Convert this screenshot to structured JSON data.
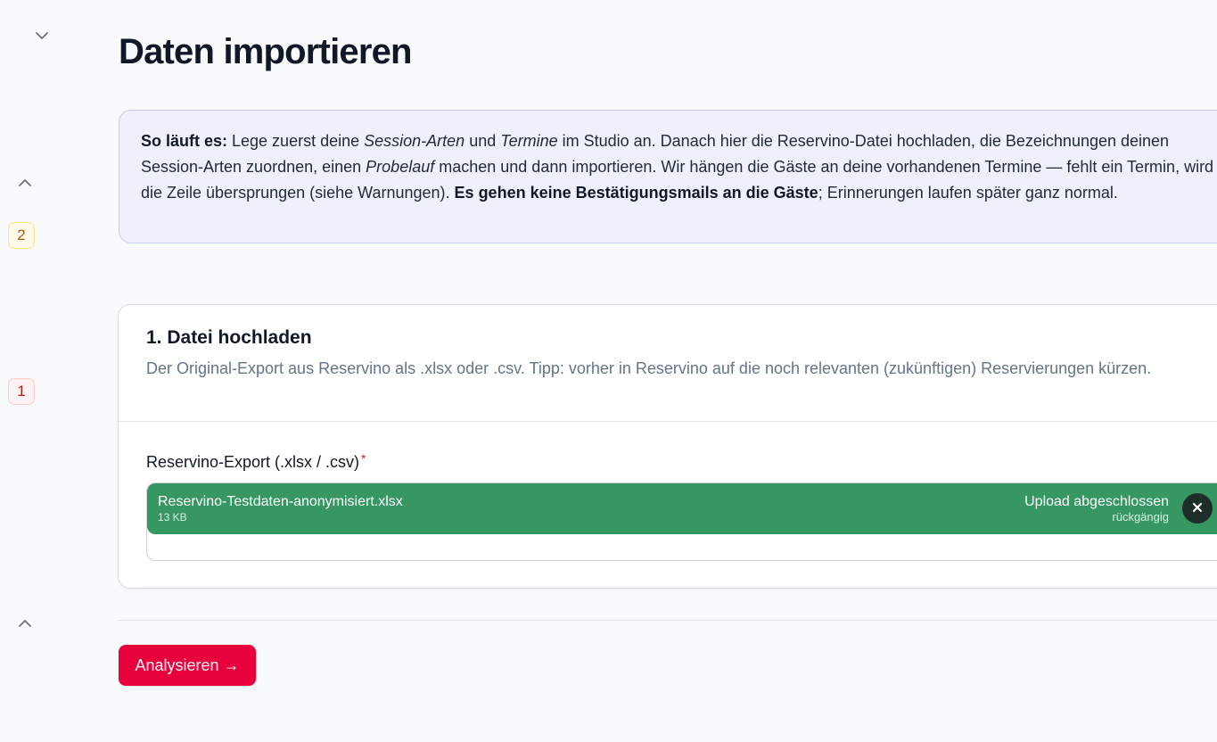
{
  "rail": {
    "badges": [
      "2",
      "1"
    ]
  },
  "page": {
    "title": "Daten importieren"
  },
  "info": {
    "lead": "So läuft es:",
    "t1": " Lege zuerst deine ",
    "em1": "Session-Arten",
    "t2": " und ",
    "em2": "Termine",
    "t3": " im Studio an. Danach hier die Reservino-Datei hochladen, die Bezeichnungen deinen Session-Arten zuordnen, einen ",
    "em3": "Probelauf",
    "t4": " machen und dann importieren. Wir hängen die Gäste an deine vorhandenen Termine — fehlt ein Termin, wird die Zeile übersprungen (siehe Warnungen). ",
    "strong": "Es gehen keine Bestätigungsmails an die Gäste",
    "t5": "; Erinnerungen laufen später ganz normal."
  },
  "upload_section": {
    "title": "1. Datei hochladen",
    "description": "Der Original-Export aus Reservino als .xlsx oder .csv. Tipp: vorher in Reservino auf die noch relevanten (zukünftigen) Reservierungen kürzen.",
    "field_label": "Reservino-Export (.xlsx / .csv)",
    "required_mark": "*",
    "file": {
      "name": "Reservino-Testdaten-anonymisiert.xlsx",
      "size": "13 KB",
      "status": "Upload abgeschlossen",
      "undo": "rückgängig"
    }
  },
  "actions": {
    "analyze": "Analysieren →"
  },
  "colors": {
    "primary": "#e8003d",
    "success": "#369763",
    "info_bg": "#eef0fb",
    "warning": "#b45309",
    "danger": "#b91c1c"
  },
  "icons": {
    "rail": [
      "chevron-down-icon",
      "chevron-up-icon",
      "chevron-up-icon"
    ],
    "remove": "close-icon"
  }
}
